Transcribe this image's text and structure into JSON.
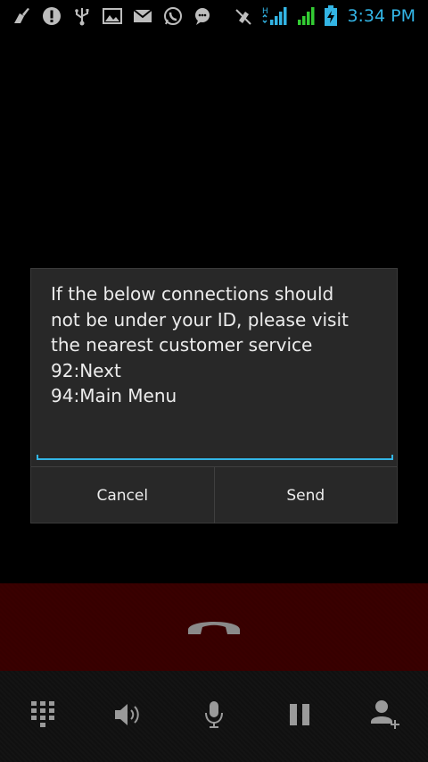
{
  "status_bar": {
    "time": "3:34 PM",
    "network_type": "H",
    "icons_left": [
      "broom-icon",
      "alert-icon",
      "usb-icon",
      "image-icon",
      "mail-icon",
      "whatsapp-icon",
      "chat-icon"
    ],
    "icons_right": [
      "muted-mic-icon",
      "signal-h-icon",
      "signal-icon",
      "battery-charging-icon"
    ],
    "accent_color": "#33b5e5"
  },
  "dialog": {
    "message": "If the below connections should\nnot be under your ID, please visit\nthe nearest customer service\n92:Next\n94:Main Menu",
    "input_value": "",
    "cancel_label": "Cancel",
    "send_label": "Send"
  },
  "in_call": {
    "end_call_icon": "end-call-icon",
    "controls": [
      "dialpad-icon",
      "speaker-icon",
      "mute-icon",
      "hold-icon",
      "add-call-icon"
    ]
  }
}
